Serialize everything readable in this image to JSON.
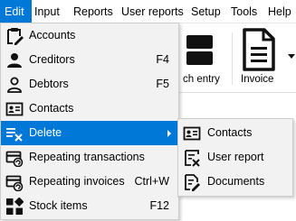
{
  "menubar": {
    "items": [
      {
        "label": "Edit"
      },
      {
        "label": "Input"
      },
      {
        "label": "Reports"
      },
      {
        "label": "User reports"
      },
      {
        "label": "Setup"
      },
      {
        "label": "Tools"
      },
      {
        "label": "Help"
      }
    ]
  },
  "toolbar": {
    "batch_entry_partial": "ch entry",
    "invoice_label": "Invoice"
  },
  "edit_menu": {
    "items": [
      {
        "label": "Accounts",
        "shortcut": "",
        "icon": "clipboard-edit-icon"
      },
      {
        "label": "Creditors",
        "shortcut": "F4",
        "icon": "person-filled-icon"
      },
      {
        "label": "Debtors",
        "shortcut": "F5",
        "icon": "person-outline-icon"
      },
      {
        "label": "Contacts",
        "shortcut": "",
        "icon": "contact-card-icon"
      },
      {
        "label": "Delete",
        "shortcut": "",
        "icon": "delete-list-icon"
      },
      {
        "label": "Repeating transactions",
        "shortcut": "",
        "icon": "repeating-transactions-icon"
      },
      {
        "label": "Repeating invoices",
        "shortcut": "Ctrl+W",
        "icon": "repeating-invoices-icon"
      },
      {
        "label": "Stock items",
        "shortcut": "F12",
        "icon": "stock-items-icon"
      }
    ]
  },
  "delete_submenu": {
    "items": [
      {
        "label": "Contacts",
        "icon": "contact-card-icon"
      },
      {
        "label": "User report",
        "icon": "user-report-icon"
      },
      {
        "label": "Documents",
        "icon": "document-edit-icon"
      }
    ]
  },
  "colors": {
    "highlight": "#0078d7",
    "menu_bg": "#f2f2f2"
  }
}
